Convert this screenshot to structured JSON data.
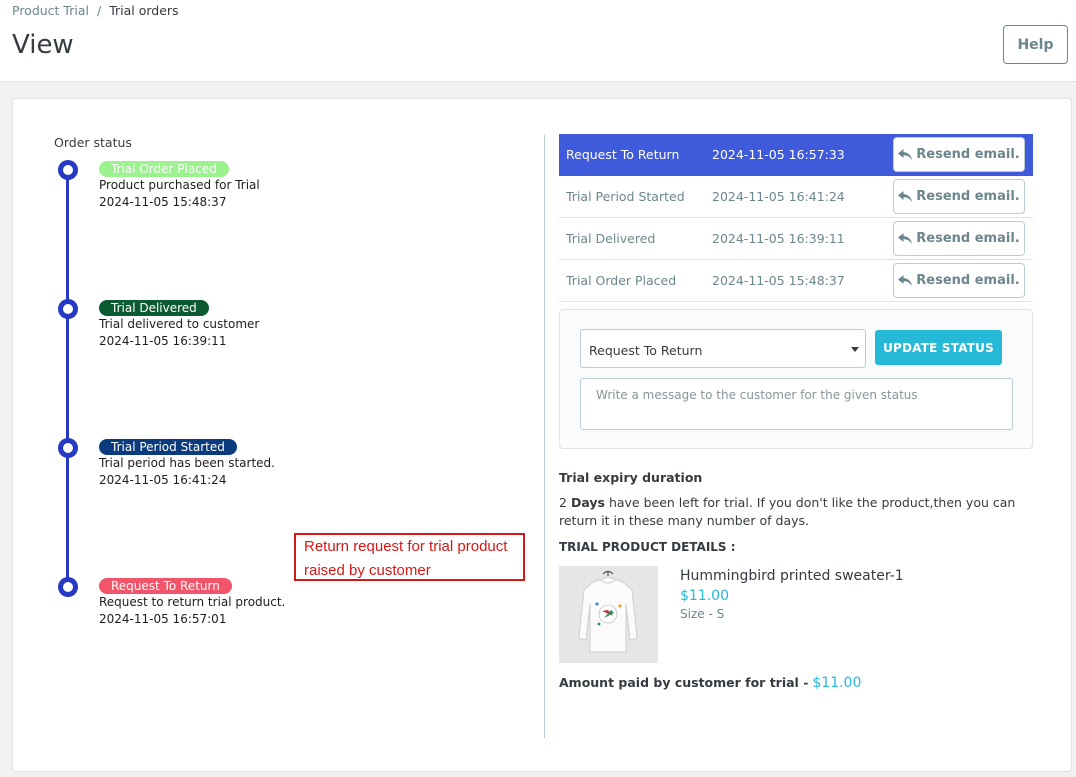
{
  "breadcrumb": {
    "parent": "Product Trial",
    "separator": "/",
    "current": "Trial orders"
  },
  "page": {
    "title": "View",
    "help_label": "Help"
  },
  "order_status": {
    "title": "Order status",
    "timeline": [
      {
        "badge": "Trial Order Placed",
        "badge_color": "#9bf28f",
        "description": "Product purchased for Trial",
        "date": "2024-11-05 15:48:37"
      },
      {
        "badge": "Trial Delivered",
        "badge_color": "#0b5a32",
        "description": "Trial delivered to customer",
        "date": "2024-11-05 16:39:11"
      },
      {
        "badge": "Trial Period Started",
        "badge_color": "#0a3c7d",
        "description": "Trial period has been started.",
        "date": "2024-11-05 16:41:24"
      },
      {
        "badge": "Request To Return",
        "badge_color": "#f2556a",
        "description": "Request to return trial product.",
        "date": "2024-11-05 16:57:01"
      }
    ]
  },
  "annotation": {
    "line1": "Return request for trial product",
    "line2": "raised by customer"
  },
  "history": [
    {
      "status": "Request To Return",
      "date": "2024-11-05 16:57:33",
      "button": "Resend email."
    },
    {
      "status": "Trial Period Started",
      "date": "2024-11-05 16:41:24",
      "button": "Resend email."
    },
    {
      "status": "Trial Delivered",
      "date": "2024-11-05 16:39:11",
      "button": "Resend email."
    },
    {
      "status": "Trial Order Placed",
      "date": "2024-11-05 15:48:37",
      "button": "Resend email."
    }
  ],
  "status_form": {
    "selected_status": "Request To Return",
    "update_label": "UPDATE STATUS",
    "message_placeholder": "Write a message to the customer for the given status"
  },
  "expiry": {
    "title": "Trial expiry duration",
    "days": "2",
    "days_unit": "Days",
    "text": "have been left for trial. If you don't like the product,then you can return it in these many number of days."
  },
  "product": {
    "section_title": "TRIAL PRODUCT DETAILS :",
    "name": "Hummingbird printed sweater-1",
    "price": "$11.00",
    "size": "Size - S"
  },
  "amount": {
    "label": "Amount paid by customer for trial -",
    "value": "$11.00"
  },
  "colors": {
    "accent": "#25b9d7",
    "active_row": "#3f5bdb",
    "timeline": "#2539c3",
    "annotation": "#d81717"
  }
}
